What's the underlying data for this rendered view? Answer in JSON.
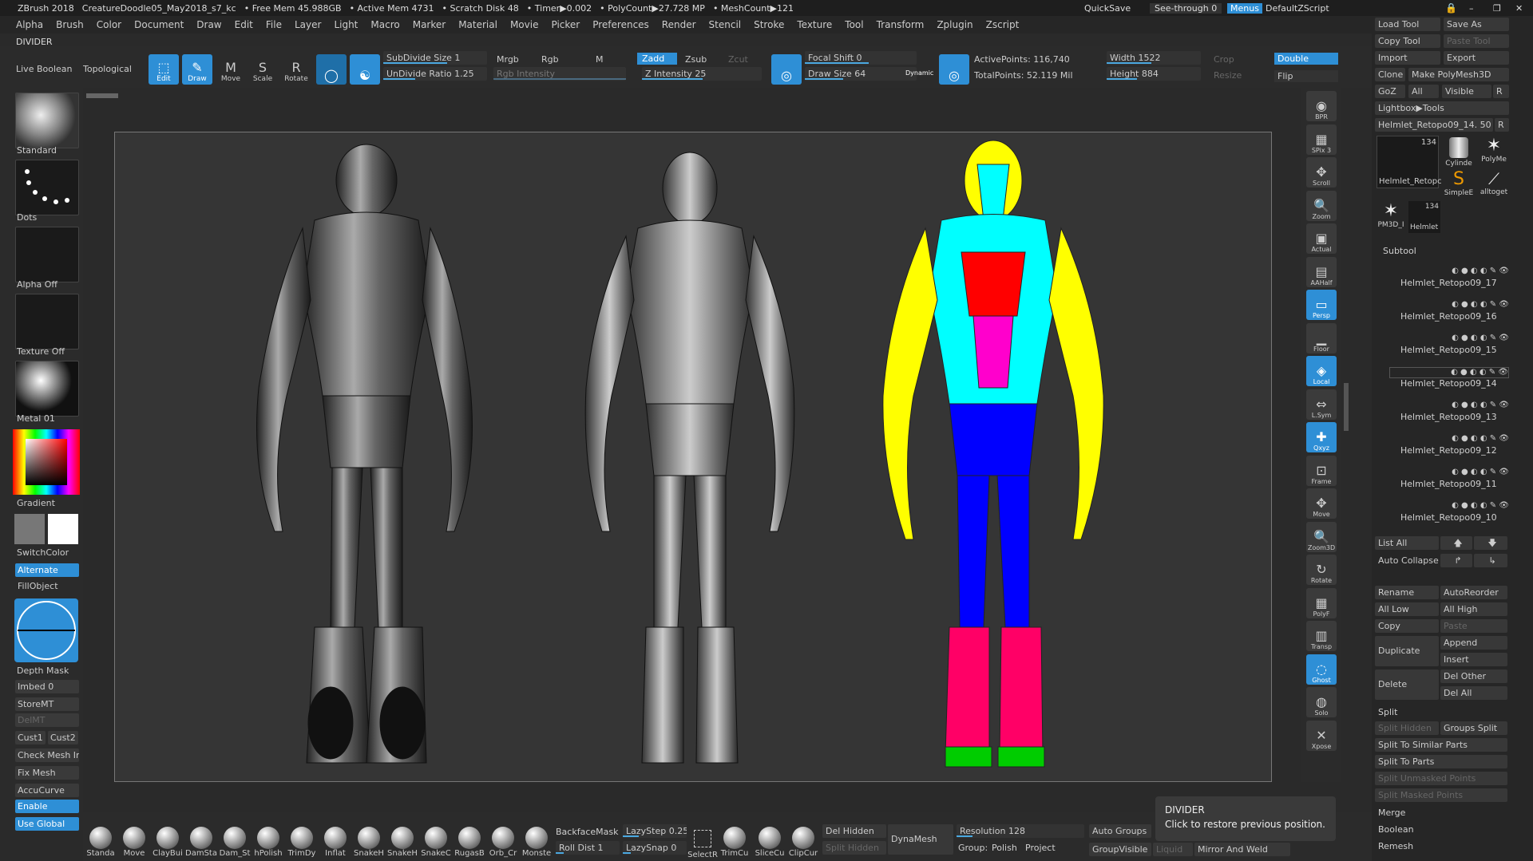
{
  "titlebar": {
    "app": "ZBrush 2018",
    "file": "CreatureDoodle05_May2018_s7_kc",
    "freemem": "• Free Mem 45.988GB",
    "activemem": "• Active Mem 4731",
    "scratch": "• Scratch Disk 48",
    "timer": "• Timer▶0.002",
    "polycount": "• PolyCount▶27.728 MP",
    "meshcount": "• MeshCount▶121",
    "quicksave": "QuickSave",
    "seethrough": "See-through  0",
    "menus": "Menus",
    "script": "DefaultZScript"
  },
  "menubar": [
    "Alpha",
    "Brush",
    "Color",
    "Document",
    "Draw",
    "Edit",
    "File",
    "Layer",
    "Light",
    "Macro",
    "Marker",
    "Material",
    "Movie",
    "Picker",
    "Preferences",
    "Render",
    "Stencil",
    "Stroke",
    "Texture",
    "Tool",
    "Transform",
    "Zplugin",
    "Zscript"
  ],
  "divider": "DIVIDER",
  "topbar": {
    "live_boolean": "Live Boolean",
    "topological": "Topological",
    "edit": "Edit",
    "draw": "Draw",
    "move": "Move",
    "scale": "Scale",
    "rotate": "Rotate",
    "subdivide": "SubDivide Size 1",
    "undivide": "UnDivide Ratio 1.25",
    "mrgb": "Mrgb",
    "rgb": "Rgb",
    "m": "M",
    "rgb_intensity": "Rgb Intensity",
    "zadd": "Zadd",
    "zsub": "Zsub",
    "zcut": "Zcut",
    "z_intensity": "Z Intensity 25",
    "focal_shift": "Focal Shift 0",
    "draw_size": "Draw Size 64",
    "dynamic": "Dynamic",
    "active_points": "ActivePoints: 116,740",
    "total_points": "TotalPoints: 52.119 Mil",
    "width": "Width 1522",
    "height": "Height 884",
    "crop": "Crop",
    "resize": "Resize",
    "double": "Double",
    "flip": "Flip"
  },
  "leftpanel": {
    "standard": "Standard",
    "dots": "Dots",
    "alpha": "Alpha Off",
    "texture": "Texture Off",
    "metal": "Metal 01",
    "gradient": "Gradient",
    "switchcolor": "SwitchColor",
    "alternate": "Alternate",
    "fillobject": "FillObject",
    "depthmask": "Depth Mask",
    "imbed": "Imbed 0",
    "storemt": "StoreMT",
    "delmt": "DelMT",
    "cust1": "Cust1",
    "cust2": "Cust2",
    "checkmesh": "Check Mesh In",
    "fixmesh": "Fix Mesh",
    "accucurve": "AccuCurve",
    "enable": "Enable",
    "useglobal": "Use Global"
  },
  "rightcol": [
    "BPR",
    "SPix 3",
    "Scroll",
    "Zoom",
    "Actual",
    "AAHalf",
    "Persp",
    "Floor",
    "Local",
    "L.Sym",
    "Qxyz",
    "Frame",
    "Move",
    "Zoom3D",
    "Rotate",
    "PolyF",
    "Transp",
    "Ghost",
    "Solo",
    "Xpose"
  ],
  "rpanel": {
    "load_tool": "Load Tool",
    "save_as": "Save As",
    "copy_tool": "Copy Tool",
    "paste_tool": "Paste Tool",
    "import": "Import",
    "export": "Export",
    "clone": "Clone",
    "make_polymesh": "Make PolyMesh3D",
    "goz": "GoZ",
    "all": "All",
    "visible": "Visible",
    "r": "R",
    "lightbox": "Lightbox▶Tools",
    "current_tool": "Helmlet_Retopo09_14. 50",
    "tool_count1": "134",
    "tool_count2": "134",
    "thumb1": "Helmlet_Retopc",
    "thumb2": "Cylinde",
    "thumb3": "PolyMe",
    "thumb4": "SimpleE",
    "thumb5": "alltoget",
    "thumb6": "PM3D_I",
    "thumb7": "Helmlet",
    "subtool": "Subtool",
    "subtools": [
      "Helmlet_Retopo09_17",
      "Helmlet_Retopo09_16",
      "Helmlet_Retopo09_15",
      "Helmlet_Retopo09_14",
      "Helmlet_Retopo09_13",
      "Helmlet_Retopo09_12",
      "Helmlet_Retopo09_11",
      "Helmlet_Retopo09_10"
    ],
    "list_all": "List All",
    "auto_collapse": "Auto Collapse",
    "rename": "Rename",
    "autoreorder": "AutoReorder",
    "all_low": "All Low",
    "all_high": "All High",
    "copy": "Copy",
    "paste": "Paste",
    "duplicate": "Duplicate",
    "append": "Append",
    "insert": "Insert",
    "delete": "Delete",
    "del_other": "Del Other",
    "del_all": "Del All",
    "split": "Split",
    "split_hidden": "Split Hidden",
    "groups_split": "Groups Split",
    "split_similar": "Split To Similar Parts",
    "split_parts": "Split To Parts",
    "split_unmasked": "Split Unmasked Points",
    "split_masked": "Split Masked Points",
    "merge": "Merge",
    "boolean": "Boolean",
    "remesh": "Remesh"
  },
  "bottombar": {
    "brushes": [
      "Standa",
      "Move",
      "ClayBui",
      "DamSta",
      "Dam_St",
      "hPolish",
      "TrimDy",
      "Inflat",
      "SnakeH",
      "SnakeH",
      "SnakeC",
      "RugasB",
      "Orb_Cr",
      "Monste"
    ],
    "backfacemask": "BackfaceMask",
    "lazystep": "LazyStep 0.25",
    "rolldist": "Roll Dist 1",
    "lazysnap": "LazySnap 0",
    "selectr": "SelectR",
    "trimcu": "TrimCu",
    "slicecu": "SliceCu",
    "clipcur": "ClipCur",
    "del_hidden": "Del Hidden",
    "split_hidden": "Split Hidden",
    "dynamesh": "DynaMesh",
    "resolution": "Resolution 128",
    "group": "Group:",
    "polish": "Polish",
    "project": "Project",
    "auto_groups": "Auto Groups",
    "groupvisible": "GroupVisible",
    "liquid": "Liquid",
    "mirror_weld": "Mirror And Weld"
  },
  "tooltip": {
    "title": "DIVIDER",
    "text": "Click to restore previous position."
  },
  "colors": {
    "accent": "#2e8fd6",
    "bg": "#2a2a2a"
  }
}
